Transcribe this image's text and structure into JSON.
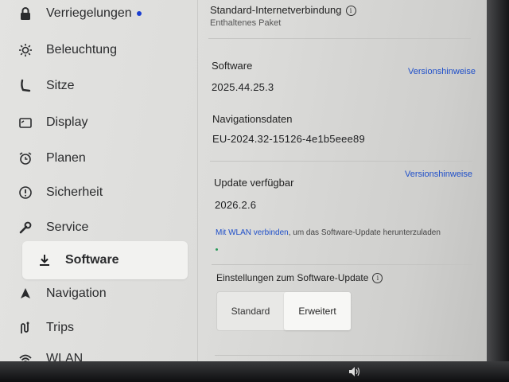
{
  "sidebar": {
    "items": [
      {
        "label": "Verriegelungen",
        "icon": "lock-icon",
        "badge": true
      },
      {
        "label": "Beleuchtung",
        "icon": "sun-icon"
      },
      {
        "label": "Sitze",
        "icon": "seat-icon"
      },
      {
        "label": "Display",
        "icon": "display-icon"
      },
      {
        "label": "Planen",
        "icon": "alarm-clock-icon"
      },
      {
        "label": "Sicherheit",
        "icon": "alert-circle-icon"
      },
      {
        "label": "Service",
        "icon": "wrench-icon"
      },
      {
        "label": "Software",
        "icon": "download-icon",
        "selected": true
      },
      {
        "label": "Navigation",
        "icon": "navigation-arrow-icon"
      },
      {
        "label": "Trips",
        "icon": "trips-icon"
      },
      {
        "label": "WLAN",
        "icon": "wifi-icon"
      }
    ]
  },
  "main": {
    "connectivity": {
      "title": "Standard-Internetverbindung",
      "subtitle": "Enthaltenes Paket"
    },
    "software": {
      "label": "Software",
      "version": "2025.44.25.3",
      "release_notes": "Versionshinweise"
    },
    "navigation_data": {
      "label": "Navigationsdaten",
      "version": "EU-2024.32-15126-4e1b5eee89"
    },
    "update": {
      "label": "Update verfügbar",
      "version": "2026.2.6",
      "release_notes": "Versionshinweise",
      "wifi_link": "Mit WLAN verbinden",
      "wifi_text": ", um das Software-Update herunterzuladen"
    },
    "update_settings": {
      "title": "Einstellungen zum Software-Update",
      "options": [
        "Standard",
        "Erweitert"
      ],
      "selected": "Erweitert"
    }
  },
  "colors": {
    "accent": "#1f4fc9",
    "badge": "#1a3ed1"
  }
}
